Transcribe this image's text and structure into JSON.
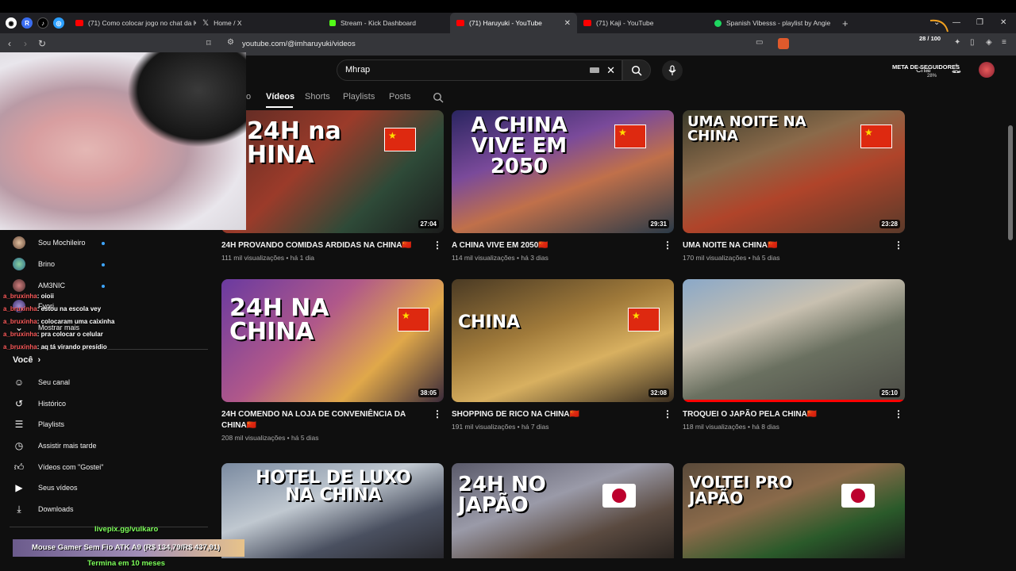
{
  "browser": {
    "tabs": [
      {
        "label": "(71) Como colocar jogo no chat da K",
        "favicon_color": "#ff0000"
      },
      {
        "label": "Home / X",
        "favicon_color": "#ffffff"
      },
      {
        "label": "Stream - Kick Dashboard",
        "favicon_color": "#53fc18"
      },
      {
        "label": "(71) Haruyuki - YouTube",
        "favicon_color": "#ff0000"
      },
      {
        "label": "(71) Kaji - YouTube",
        "favicon_color": "#ff0000"
      },
      {
        "label": "Spanish Vibesss - playlist by Angie",
        "favicon_color": "#1ed760"
      }
    ],
    "url": "youtube.com/@imharuyuki/videos"
  },
  "youtube": {
    "search_value": "Mhrap",
    "channel_tabs": [
      "o",
      "Vídeos",
      "Shorts",
      "Playlists",
      "Posts"
    ],
    "create_label": "Criar",
    "videos": [
      {
        "title": "24H PROVANDO COMIDAS ARDIDAS NA CHINA🇨🇳",
        "views": "111 mil visualizações • há 1 dia",
        "duration": "27:04",
        "thumb_text": "24H na\nHINA"
      },
      {
        "title": "A CHINA VIVE EM 2050🇨🇳",
        "views": "114 mil visualizações • há 3 dias",
        "duration": "29:31",
        "thumb_text": "A CHINA\nVIVE EM\n2050"
      },
      {
        "title": "UMA NOITE NA CHINA🇨🇳",
        "views": "170 mil visualizações • há 5 dias",
        "duration": "23:28",
        "thumb_text": "UMA NOITE NA\nCHINA"
      },
      {
        "title": "24H COMENDO NA LOJA DE CONVENIÊNCIA DA CHINA🇨🇳",
        "views": "208 mil visualizações • há 5 dias",
        "duration": "38:05",
        "thumb_text": "24H NA\nCHINA"
      },
      {
        "title": "SHOPPING DE RICO NA CHINA🇨🇳",
        "views": "191 mil visualizações • há 7 dias",
        "duration": "32:08",
        "thumb_text": "CHINA"
      },
      {
        "title": "TROQUEI O JAPÃO PELA CHINA🇨🇳",
        "views": "118 mil visualizações • há 8 dias",
        "duration": "25:10",
        "thumb_text": ""
      },
      {
        "title": "",
        "views": "",
        "duration": "",
        "thumb_text": "HOTEL DE LUXO\nNA CHINA"
      },
      {
        "title": "",
        "views": "",
        "duration": "",
        "thumb_text": "24H NO\nJAPÃO"
      },
      {
        "title": "",
        "views": "",
        "duration": "",
        "thumb_text": "VOLTEI PRO\nJAPÃO"
      }
    ]
  },
  "sidebar": {
    "subscriptions": [
      "Sou Mochileiro",
      "Brino",
      "AM3NIC",
      "Fyori"
    ],
    "show_more": "Mostrar mais",
    "you_heading": "Você",
    "you_items": [
      "Seu canal",
      "Histórico",
      "Playlists",
      "Assistir mais tarde",
      "Vídeos com \"Gostei\"",
      "Seus vídeos",
      "Downloads"
    ]
  },
  "overlay": {
    "chat": [
      {
        "user": "a_bruxinha",
        "msg": ": oioii"
      },
      {
        "user": "a_bruxinha",
        "msg": ": estou na escola vey"
      },
      {
        "user": "a_bruxinha",
        "msg": ": colocaram uma caixinha"
      },
      {
        "user": "a_bruxinha",
        "msg": ": pra colocar o celular"
      },
      {
        "user": "a_bruxinha",
        "msg": ": aq tá virando presídio"
      }
    ],
    "livepix": "livepix.gg/vulkaro",
    "promo": "Mouse Gamer Sem Fio ATK A9 (R$ 134,79/R$ 437,91)",
    "ends": "Termina em 10 meses",
    "goal_label": "META DE SEGUIDORES",
    "goal_count": "28 / 100",
    "goal_percent": "28%"
  }
}
